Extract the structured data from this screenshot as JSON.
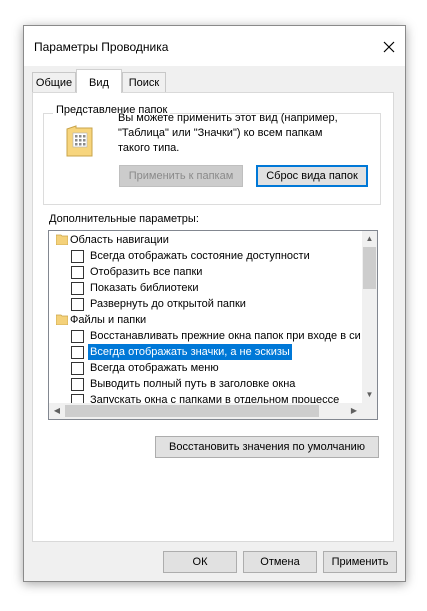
{
  "window": {
    "title": "Параметры Проводника"
  },
  "tabs": [
    {
      "label": "Общие",
      "active": false
    },
    {
      "label": "Вид",
      "active": true
    },
    {
      "label": "Поиск",
      "active": false
    }
  ],
  "folder_view": {
    "legend": "Представление папок",
    "description_lines": [
      "Вы можете применить этот вид (например,",
      "\"Таблица\" или \"Значки\") ко всем папкам",
      "такого типа."
    ],
    "apply_button": "Применить к папкам",
    "reset_button": "Сброс вида папок"
  },
  "advanced": {
    "label": "Дополнительные параметры:",
    "items": [
      {
        "type": "category",
        "label": "Область навигации"
      },
      {
        "type": "checkbox",
        "label": "Всегда отображать состояние доступности",
        "checked": false
      },
      {
        "type": "checkbox",
        "label": "Отобразить все папки",
        "checked": false
      },
      {
        "type": "checkbox",
        "label": "Показать библиотеки",
        "checked": false
      },
      {
        "type": "checkbox",
        "label": "Развернуть до открытой папки",
        "checked": false
      },
      {
        "type": "category",
        "label": "Файлы и папки"
      },
      {
        "type": "checkbox",
        "label": "Восстанавливать прежние окна папок при входе в си",
        "checked": false
      },
      {
        "type": "checkbox",
        "label": "Всегда отображать значки, а не эскизы",
        "checked": false,
        "selected": true
      },
      {
        "type": "checkbox",
        "label": "Всегда отображать меню",
        "checked": false
      },
      {
        "type": "checkbox",
        "label": "Выводить полный путь в заголовке окна",
        "checked": false
      },
      {
        "type": "checkbox",
        "label": "Запускать окна с папками в отдельном процессе",
        "checked": false
      }
    ]
  },
  "restore_defaults_button": "Восстановить значения по умолчанию",
  "footer": {
    "ok": "ОК",
    "cancel": "Отмена",
    "apply": "Применить"
  },
  "colors": {
    "selection": "#0078d7",
    "accent_border": "#0078d7",
    "dialog_bg": "#f0f0f0"
  }
}
